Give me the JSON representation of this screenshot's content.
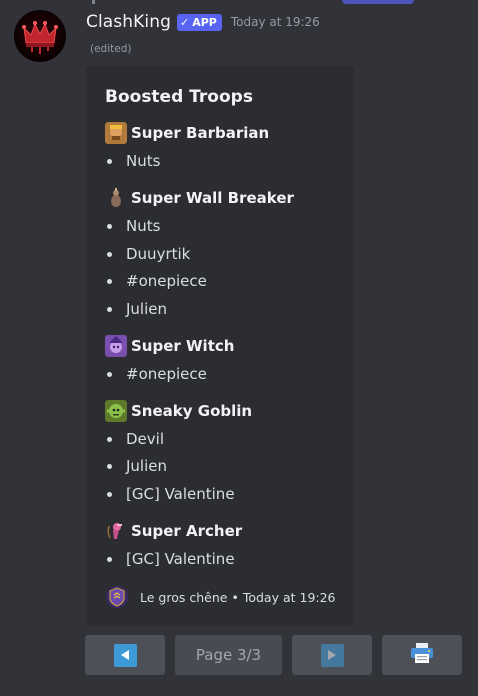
{
  "message": {
    "username": "ClashKing",
    "badge": "APP",
    "badge_check": "✓",
    "timestamp": "Today at 19:26",
    "edited": "(edited)"
  },
  "embed": {
    "title": "Boosted Troops",
    "troops": [
      {
        "name": "Super Barbarian",
        "icon": "super-barbarian-icon",
        "members": [
          "Nuts"
        ]
      },
      {
        "name": "Super Wall Breaker",
        "icon": "super-wall-breaker-icon",
        "members": [
          "Nuts",
          "Duuyrtik",
          "#onepiece",
          "Julien"
        ]
      },
      {
        "name": "Super Witch",
        "icon": "super-witch-icon",
        "members": [
          "#onepiece"
        ]
      },
      {
        "name": "Sneaky Goblin",
        "icon": "sneaky-goblin-icon",
        "members": [
          "Devil",
          "Julien",
          "[GC] Valentine"
        ]
      },
      {
        "name": "Super Archer",
        "icon": "super-archer-icon",
        "members": [
          "[GC] Valentine"
        ]
      }
    ],
    "footer": {
      "clan": "Le gros chêne",
      "separator": "•",
      "timestamp": "Today at 19:26"
    }
  },
  "buttons": {
    "previous": "previous-arrow-icon",
    "page": "Page 3/3",
    "next": "next-arrow-icon",
    "print": "printer-icon"
  },
  "colors": {
    "background": "#313338",
    "embed": "#2b2d31",
    "brand": "#5865f2",
    "button": "#4e5058",
    "arrow": "#3e9ad6"
  }
}
